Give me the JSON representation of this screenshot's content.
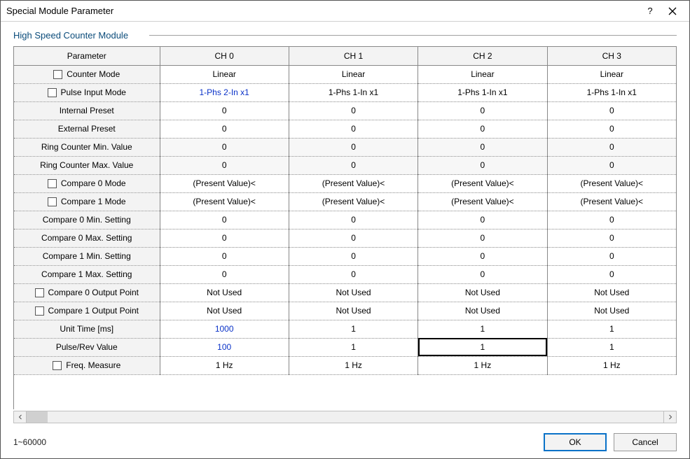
{
  "window": {
    "title": "Special Module Parameter",
    "help_label": "?",
    "close_label": "×"
  },
  "section": {
    "title": "High Speed Counter Module"
  },
  "grid": {
    "headers": [
      "Parameter",
      "CH 0",
      "CH 1",
      "CH 2",
      "CH 3"
    ],
    "rows": [
      {
        "param": "Counter Mode",
        "checkbox": true,
        "shaded": false,
        "cells": [
          "Linear",
          "Linear",
          "Linear",
          "Linear"
        ],
        "blue": [
          false,
          false,
          false,
          false
        ]
      },
      {
        "param": "Pulse Input Mode",
        "checkbox": true,
        "shaded": false,
        "cells": [
          "1-Phs 2-In x1",
          "1-Phs 1-In x1",
          "1-Phs 1-In x1",
          "1-Phs 1-In x1"
        ],
        "blue": [
          true,
          false,
          false,
          false
        ]
      },
      {
        "param": "Internal Preset",
        "checkbox": false,
        "shaded": false,
        "cells": [
          "0",
          "0",
          "0",
          "0"
        ],
        "blue": [
          false,
          false,
          false,
          false
        ]
      },
      {
        "param": "External Preset",
        "checkbox": false,
        "shaded": false,
        "cells": [
          "0",
          "0",
          "0",
          "0"
        ],
        "blue": [
          false,
          false,
          false,
          false
        ]
      },
      {
        "param": "Ring Counter Min. Value",
        "checkbox": false,
        "shaded": true,
        "cells": [
          "0",
          "0",
          "0",
          "0"
        ],
        "blue": [
          false,
          false,
          false,
          false
        ]
      },
      {
        "param": "Ring Counter Max. Value",
        "checkbox": false,
        "shaded": true,
        "cells": [
          "0",
          "0",
          "0",
          "0"
        ],
        "blue": [
          false,
          false,
          false,
          false
        ]
      },
      {
        "param": "Compare 0 Mode",
        "checkbox": true,
        "shaded": false,
        "cells": [
          "(Present Value)<",
          "(Present Value)<",
          "(Present Value)<",
          "(Present Value)<"
        ],
        "blue": [
          false,
          false,
          false,
          false
        ]
      },
      {
        "param": "Compare 1 Mode",
        "checkbox": true,
        "shaded": false,
        "cells": [
          "(Present Value)<",
          "(Present Value)<",
          "(Present Value)<",
          "(Present Value)<"
        ],
        "blue": [
          false,
          false,
          false,
          false
        ]
      },
      {
        "param": "Compare 0 Min. Setting",
        "checkbox": false,
        "shaded": false,
        "cells": [
          "0",
          "0",
          "0",
          "0"
        ],
        "blue": [
          false,
          false,
          false,
          false
        ]
      },
      {
        "param": "Compare 0 Max. Setting",
        "checkbox": false,
        "shaded": false,
        "cells": [
          "0",
          "0",
          "0",
          "0"
        ],
        "blue": [
          false,
          false,
          false,
          false
        ]
      },
      {
        "param": "Compare 1 Min. Setting",
        "checkbox": false,
        "shaded": false,
        "cells": [
          "0",
          "0",
          "0",
          "0"
        ],
        "blue": [
          false,
          false,
          false,
          false
        ]
      },
      {
        "param": "Compare 1 Max. Setting",
        "checkbox": false,
        "shaded": false,
        "cells": [
          "0",
          "0",
          "0",
          "0"
        ],
        "blue": [
          false,
          false,
          false,
          false
        ]
      },
      {
        "param": "Compare 0 Output Point",
        "checkbox": true,
        "shaded": false,
        "cells": [
          "Not Used",
          "Not Used",
          "Not Used",
          "Not Used"
        ],
        "blue": [
          false,
          false,
          false,
          false
        ]
      },
      {
        "param": "Compare 1 Output Point",
        "checkbox": true,
        "shaded": false,
        "cells": [
          "Not Used",
          "Not Used",
          "Not Used",
          "Not Used"
        ],
        "blue": [
          false,
          false,
          false,
          false
        ]
      },
      {
        "param": "Unit Time [ms]",
        "checkbox": false,
        "shaded": false,
        "cells": [
          "1000",
          "1",
          "1",
          "1"
        ],
        "blue": [
          true,
          false,
          false,
          false
        ]
      },
      {
        "param": "Pulse/Rev Value",
        "checkbox": false,
        "shaded": false,
        "cells": [
          "100",
          "1",
          "1",
          "1"
        ],
        "blue": [
          true,
          false,
          false,
          false
        ],
        "selected": [
          false,
          false,
          true,
          false
        ]
      },
      {
        "param": "Freq. Measure",
        "checkbox": true,
        "shaded": false,
        "cells": [
          "1 Hz",
          "1 Hz",
          "1 Hz",
          "1 Hz"
        ],
        "blue": [
          false,
          false,
          false,
          false
        ]
      }
    ]
  },
  "footer": {
    "status": "1~60000",
    "ok": "OK",
    "cancel": "Cancel"
  }
}
